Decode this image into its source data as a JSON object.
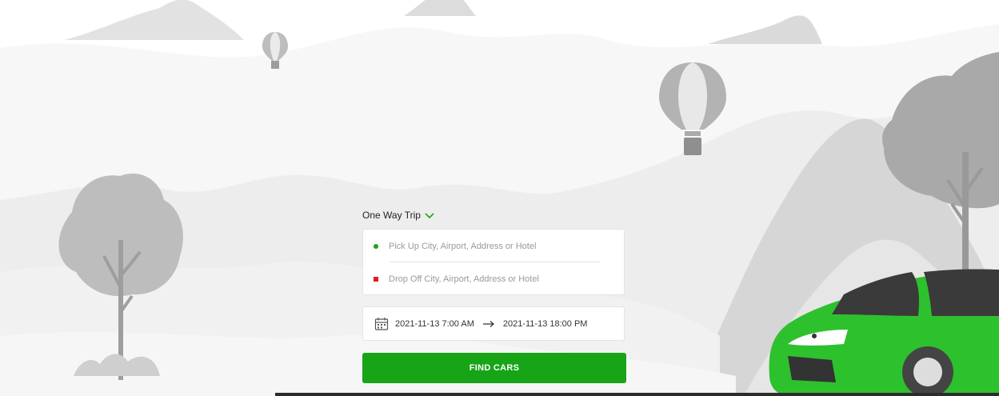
{
  "trip_type": {
    "label": "One Way Trip"
  },
  "pickup": {
    "placeholder": "Pick Up City, Airport, Address or Hotel",
    "value": ""
  },
  "dropoff": {
    "placeholder": "Drop Off City, Airport, Address or Hotel",
    "value": ""
  },
  "dates": {
    "start": "2021-11-13 7:00 AM",
    "end": "2021-11-13 18:00 PM"
  },
  "search": {
    "button_label": "FIND CARS"
  },
  "icons": {
    "trip_type": "chevron-down-icon",
    "pickup": "green-dot-icon",
    "dropoff": "red-square-icon",
    "calendar": "calendar-icon",
    "date_range": "arrow-right-icon"
  },
  "colors": {
    "accent": "#17a417",
    "car": "#2ec12e",
    "dropoff_marker": "#e11d1d",
    "scenery": "#c8c8c8"
  }
}
